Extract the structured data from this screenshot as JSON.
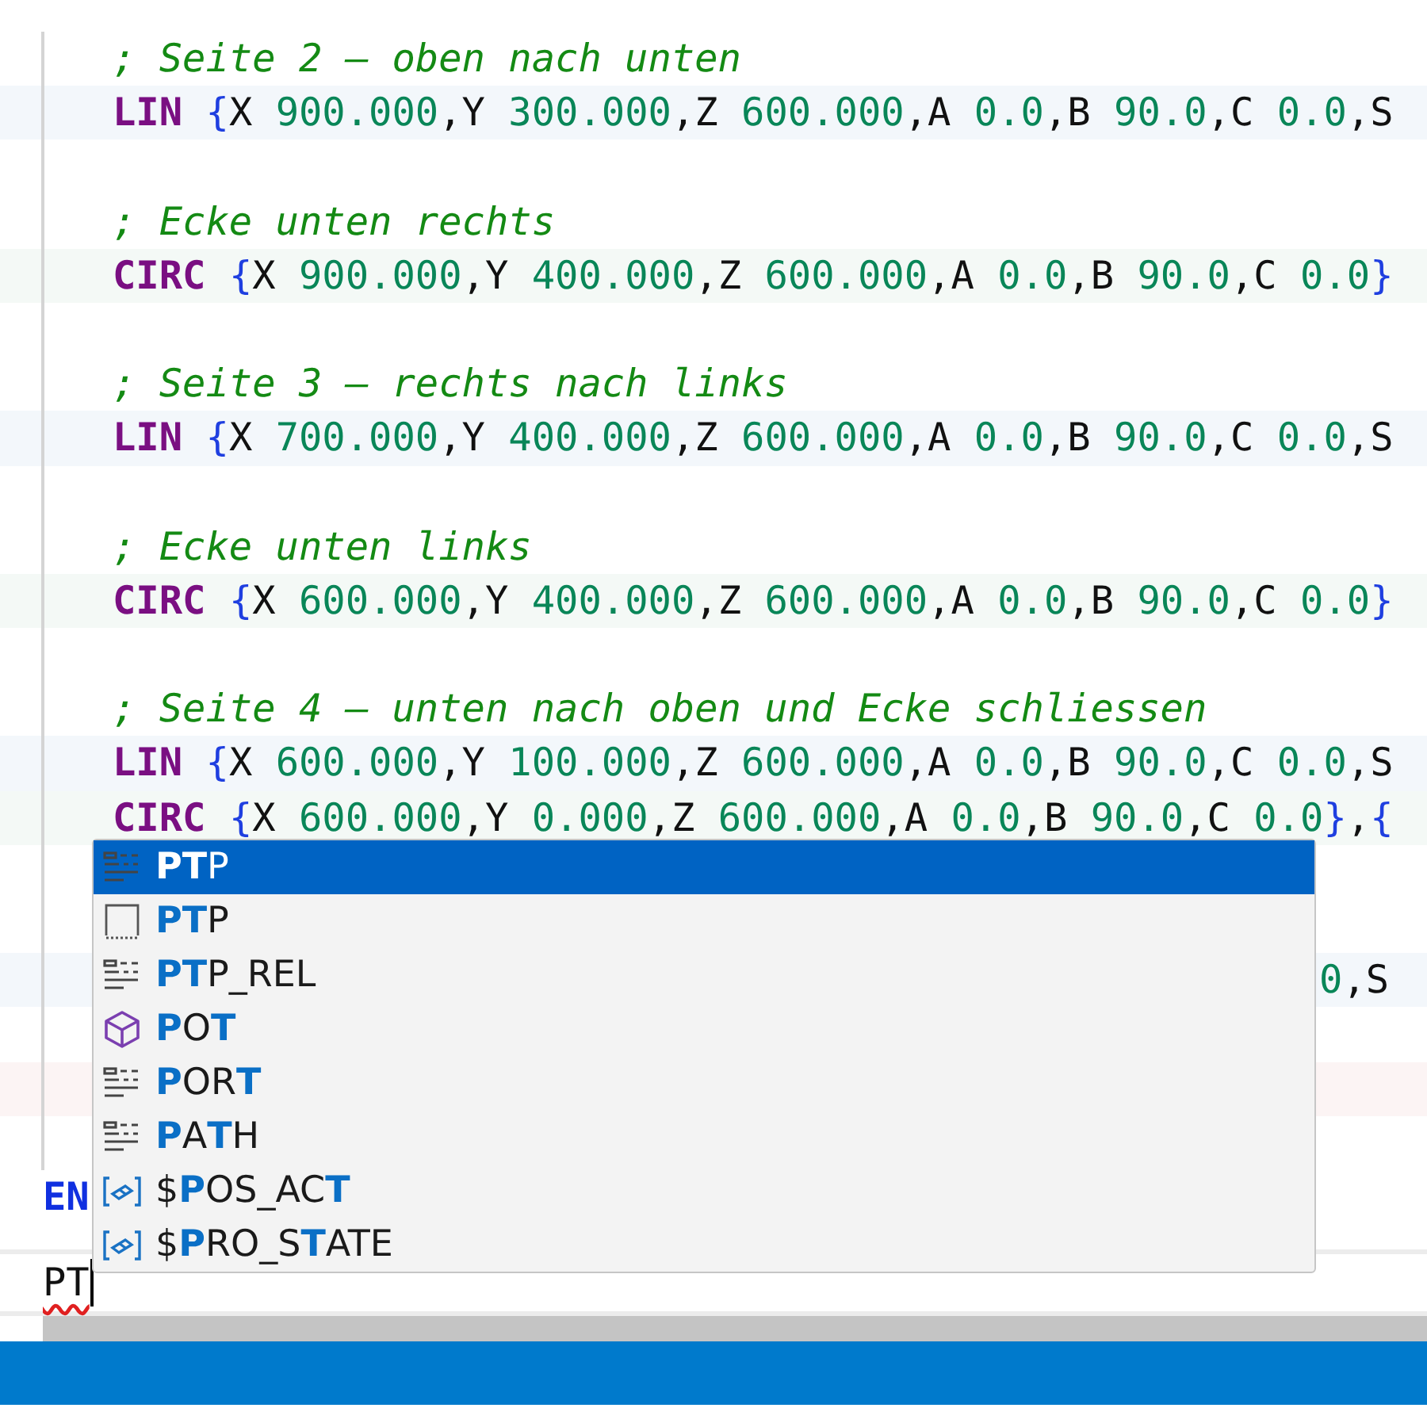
{
  "editor": {
    "lines": [
      {
        "kind": "comment",
        "text": "; Seite 2 – oben nach unten"
      },
      {
        "kind": "lin",
        "text": "LIN {X 900.000,Y 300.000,Z 600.000,A 0.0,B 90.0,C 0.0,S"
      },
      {
        "kind": "blank"
      },
      {
        "kind": "comment",
        "text": "; Ecke unten rechts"
      },
      {
        "kind": "circ",
        "text": "CIRC {X 900.000,Y 400.000,Z 600.000,A 0.0,B 90.0,C 0.0}"
      },
      {
        "kind": "blank"
      },
      {
        "kind": "comment",
        "text": "; Seite 3 – rechts nach links"
      },
      {
        "kind": "lin",
        "text": "LIN {X 700.000,Y 400.000,Z 600.000,A 0.0,B 90.0,C 0.0,S"
      },
      {
        "kind": "blank"
      },
      {
        "kind": "comment",
        "text": "; Ecke unten links"
      },
      {
        "kind": "circ",
        "text": "CIRC {X 600.000,Y 400.000,Z 600.000,A 0.0,B 90.0,C 0.0}"
      },
      {
        "kind": "blank"
      },
      {
        "kind": "comment",
        "text": "; Seite 4 – unten nach oben und Ecke schliessen"
      },
      {
        "kind": "lin",
        "text": "LIN {X 600.000,Y 100.000,Z 600.000,A 0.0,B 90.0,C 0.0,S"
      },
      {
        "kind": "circ",
        "text": "CIRC {X 600.000,Y 0.000,Z 600.000,A 0.0,B 90.0,C 0.0},{"
      },
      {
        "kind": "blank"
      },
      {
        "kind": "blank"
      },
      {
        "kind": "partial",
        "text": "0,S"
      },
      {
        "kind": "blank"
      },
      {
        "kind": "mark"
      },
      {
        "kind": "blank"
      },
      {
        "kind": "end",
        "text": "EN"
      }
    ],
    "input": {
      "value": "PT"
    }
  },
  "suggestions": [
    {
      "kind": "snippet",
      "label": "**PT**P",
      "selected": true
    },
    {
      "kind": "text",
      "label": "**PT**P",
      "selected": false
    },
    {
      "kind": "snippet",
      "label": "**PT**P_REL",
      "selected": false
    },
    {
      "kind": "module",
      "label": "**P**O**T**",
      "selected": false
    },
    {
      "kind": "snippet",
      "label": "**P**OR**T**",
      "selected": false
    },
    {
      "kind": "snippet",
      "label": "**P**A**T**H",
      "selected": false
    },
    {
      "kind": "variable",
      "label": "$**P**OS_AC**T**",
      "selected": false
    },
    {
      "kind": "variable",
      "label": "$**P**RO_S**T**ATE",
      "selected": false
    }
  ]
}
